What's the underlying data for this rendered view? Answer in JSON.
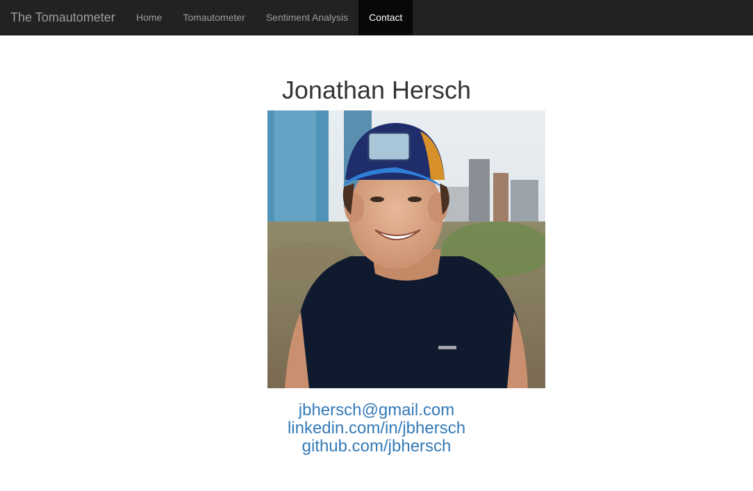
{
  "navbar": {
    "brand": "The Tomautometer",
    "items": [
      {
        "label": "Home"
      },
      {
        "label": "Tomautometer"
      },
      {
        "label": "Sentiment Analysis"
      },
      {
        "label": "Contact"
      }
    ],
    "active": "Contact",
    "colors": {
      "background": "#222222",
      "text": "#9d9d9d",
      "active_background": "#080808",
      "active_text": "#ffffff"
    }
  },
  "contact": {
    "name": "Jonathan Hersch",
    "photo": "profile-photo",
    "links": [
      {
        "label": "jbhersch@gmail.com"
      },
      {
        "label": "linkedin.com/in/jbhersch"
      },
      {
        "label": "github.com/jbhersch"
      }
    ],
    "link_color": "#337ab7"
  }
}
